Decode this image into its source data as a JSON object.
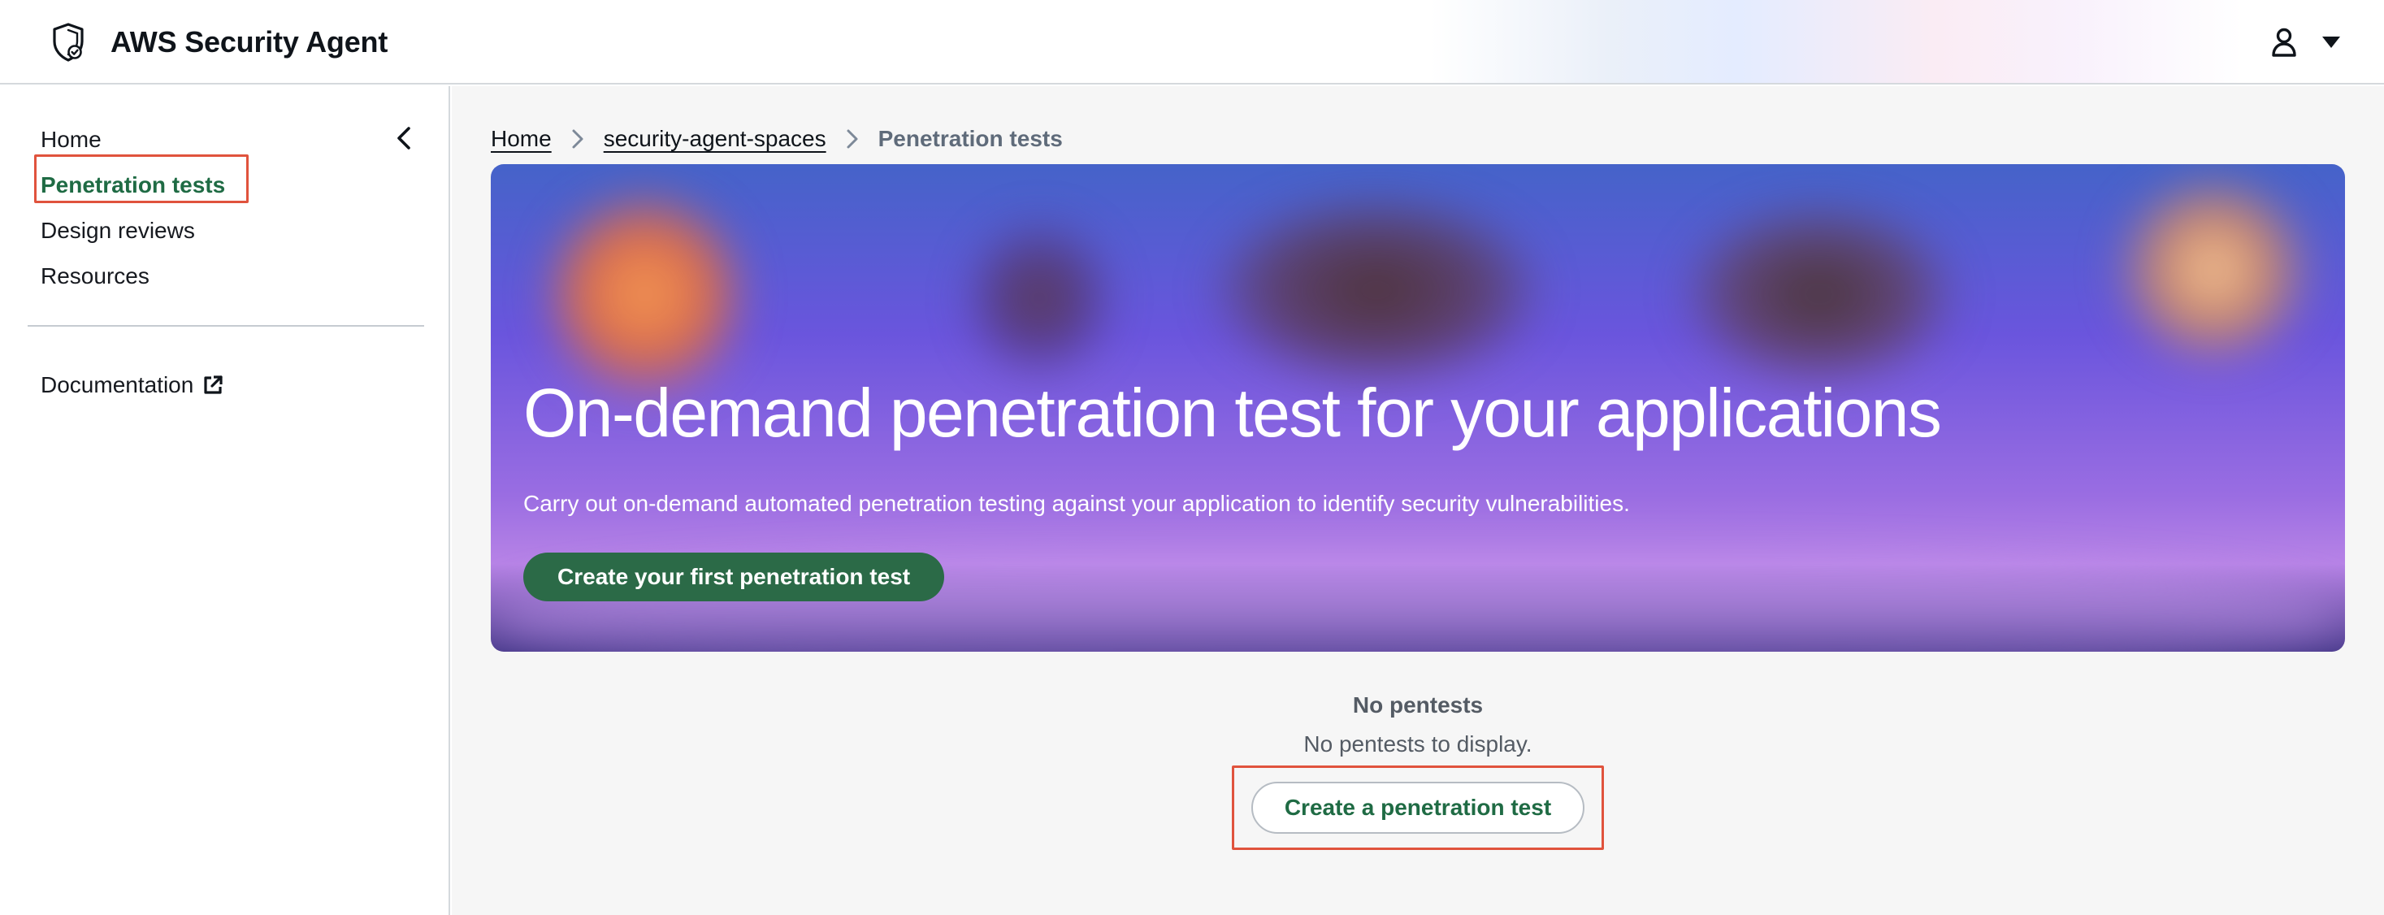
{
  "header": {
    "app_title": "AWS Security Agent",
    "logo_icon": "shield-check-icon",
    "user_icon": "user-icon",
    "menu_icon": "caret-down-icon"
  },
  "sidebar": {
    "items": [
      {
        "label": "Home"
      },
      {
        "label": "Penetration tests",
        "active": true
      },
      {
        "label": "Design reviews"
      },
      {
        "label": "Resources"
      }
    ],
    "documentation_label": "Documentation",
    "collapse_icon": "chevron-left-icon",
    "external_icon": "external-link-icon"
  },
  "breadcrumb": {
    "items": [
      "Home",
      "security-agent-spaces"
    ],
    "current": "Penetration tests"
  },
  "hero": {
    "title": "On-demand penetration test for your applications",
    "description": "Carry out on-demand automated penetration testing against your application to identify security vulnerabilities.",
    "button_label": "Create your first penetration test"
  },
  "empty_state": {
    "title": "No pentests",
    "description": "No pentests to display.",
    "button_label": "Create a penetration test"
  },
  "colors": {
    "accent_green": "#1f6b44",
    "hero_button": "#2b6a47",
    "highlight_border": "#e0533d"
  }
}
